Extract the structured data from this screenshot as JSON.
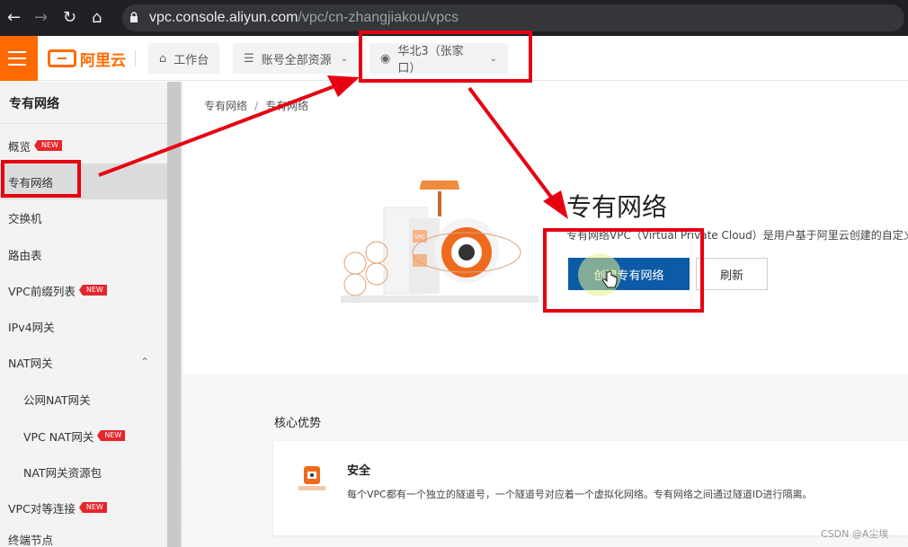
{
  "browser": {
    "url_host": "vpc.console.aliyun.com",
    "url_path": "/vpc/cn-zhangjiakou/vpcs"
  },
  "topbar": {
    "logo_text": "阿里云",
    "workbench_label": "工作台",
    "resources_label": "账号全部资源",
    "region_label": "华北3（张家口）"
  },
  "sidebar": {
    "title": "专有网络",
    "items": [
      {
        "label": "概览",
        "badge": "NEW"
      },
      {
        "label": "专有网络",
        "badge": ""
      },
      {
        "label": "交换机",
        "badge": ""
      },
      {
        "label": "路由表",
        "badge": ""
      },
      {
        "label": "VPC前缀列表",
        "badge": "NEW"
      },
      {
        "label": "IPv4网关",
        "badge": ""
      },
      {
        "label": "NAT网关",
        "badge": ""
      },
      {
        "label": "公网NAT网关",
        "badge": ""
      },
      {
        "label": "VPC NAT网关",
        "badge": "NEW"
      },
      {
        "label": "NAT网关资源包",
        "badge": ""
      },
      {
        "label": "VPC对等连接",
        "badge": "NEW"
      },
      {
        "label": "终端节点",
        "badge": ""
      }
    ]
  },
  "breadcrumb": {
    "root": "专有网络",
    "sep": "/",
    "current": "专有网络"
  },
  "main": {
    "title": "专有网络",
    "description": "专有网络VPC（Virtual Private Cloud）是用户基于阿里云创建的自定义私",
    "create_button": "创建专有网络",
    "refresh_button": "刷新",
    "advantages_title": "核心优势",
    "card_title": "安全",
    "card_desc": "每个VPC都有一个独立的隧道号，一个隧道号对应着一个虚拟化网络。专有网络之间通过隧道ID进行隔离。",
    "illus_tag": "VPC"
  },
  "watermark": "CSDN @A尘埃",
  "colors": {
    "brand": "#ff6a00",
    "primary": "#0d5aa7",
    "annotation": "#e60012"
  }
}
